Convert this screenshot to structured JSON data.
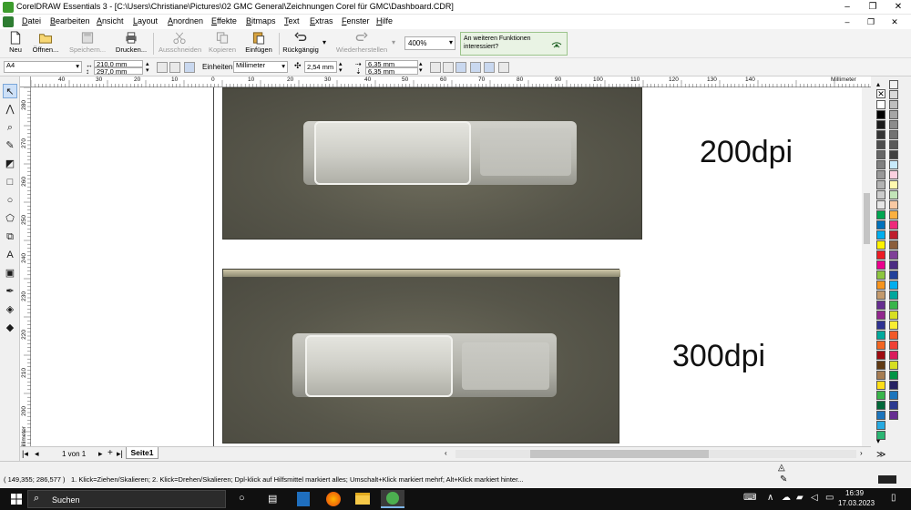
{
  "window": {
    "title": "CorelDRAW Essentials 3 - [C:\\Users\\Christiane\\Pictures\\02 GMC General\\Zeichnungen Corel für GMC\\Dashboard.CDR]",
    "controls": [
      "–",
      "❐",
      "✕"
    ]
  },
  "menu": {
    "items": [
      "Datei",
      "Bearbeiten",
      "Ansicht",
      "Layout",
      "Anordnen",
      "Effekte",
      "Bitmaps",
      "Text",
      "Extras",
      "Fenster",
      "Hilfe"
    ],
    "doc_controls": [
      "–",
      "❐",
      "✕"
    ]
  },
  "toolbar": {
    "buttons": [
      {
        "label": "Neu",
        "icon": "new-document-icon",
        "enabled": true
      },
      {
        "label": "Öffnen...",
        "icon": "open-folder-icon",
        "enabled": true
      },
      {
        "label": "Speichern...",
        "icon": "save-icon",
        "enabled": false
      },
      {
        "label": "Drucken...",
        "icon": "printer-icon",
        "enabled": true
      },
      {
        "label": "Ausschneiden",
        "icon": "scissors-icon",
        "enabled": false
      },
      {
        "label": "Kopieren",
        "icon": "copy-icon",
        "enabled": false
      },
      {
        "label": "Einfügen",
        "icon": "paste-icon",
        "enabled": true
      },
      {
        "label": "Rückgängig",
        "icon": "undo-icon",
        "enabled": true
      },
      {
        "label": "Wiederherstellen",
        "icon": "redo-icon",
        "enabled": false
      }
    ],
    "zoom": "400%",
    "promo_line1": "An weiteren Funktionen",
    "promo_line2": "interessiert?"
  },
  "propbar": {
    "page_size": "A4",
    "width": "210,0 mm",
    "height": "297,0 mm",
    "units_label": "Einheiten:",
    "units": "Millimeter",
    "nudge": "2,54 mm",
    "dup_x": "6,35 mm",
    "dup_y": "6,35 mm"
  },
  "rulers": {
    "h_ticks": [
      "40",
      "30",
      "20",
      "10",
      "0",
      "10",
      "20",
      "30",
      "40",
      "50",
      "60",
      "70",
      "80",
      "90",
      "100",
      "110",
      "120",
      "130",
      "140"
    ],
    "h_unit": "Millimeter",
    "v_ticks": [
      "280",
      "270",
      "260",
      "250",
      "240",
      "230",
      "220",
      "210",
      "200"
    ],
    "v_unit": "Millimeter"
  },
  "canvas": {
    "label_top": "200dpi",
    "label_bottom": "300dpi"
  },
  "navigation": {
    "page_count": "1 von 1",
    "page_tab": "Seite1"
  },
  "status": {
    "coords": "( 149,355; 286,577 )",
    "hint": "1. Klick=Ziehen/Skalieren; 2. Klick=Drehen/Skalieren; Dpl-klick auf Hilfsmittel markiert alles; Umschalt+Klick markiert mehrf; Alt+Klick markiert hinter..."
  },
  "taskbar": {
    "search_placeholder": "Suchen",
    "time": "16:39",
    "date": "17.03.2023"
  },
  "palette": {
    "colors_left": [
      "#ffffff",
      "#000000",
      "#1a1a1a",
      "#333333",
      "#4d4d4d",
      "#666666",
      "#808080",
      "#999999",
      "#b3b3b3",
      "#cccccc",
      "#e6e6e6",
      "#00a651",
      "#0072bc",
      "#00aeef",
      "#fff200",
      "#ed1c24",
      "#ec008c",
      "#8dc63f",
      "#f7941d",
      "#c49a6c",
      "#662d91",
      "#92278f",
      "#2e3192",
      "#00a99d",
      "#f26522",
      "#9e0b0f",
      "#603913",
      "#a67c52",
      "#ffde17",
      "#39b54a",
      "#006838",
      "#1b75bc",
      "#27aae1",
      "#2bb673"
    ],
    "colors_right": [
      "#f2f2f2",
      "#d9d9d9",
      "#bfbfbf",
      "#a6a6a6",
      "#8c8c8c",
      "#737373",
      "#5a5a5a",
      "#404040",
      "#c7eafb",
      "#fbd0e0",
      "#fff9ae",
      "#c2e5b8",
      "#f9c9a3",
      "#fbb040",
      "#ee2a7b",
      "#be1e2d",
      "#8b5e3c",
      "#7f3f98",
      "#4b2c83",
      "#21409a",
      "#00aeef",
      "#00a79d",
      "#39b54a",
      "#d7df23",
      "#f9ed32",
      "#f15a29",
      "#ef4136",
      "#da1c5c",
      "#d6de23",
      "#009444",
      "#262262",
      "#1c75bc",
      "#2b3990",
      "#662d91"
    ]
  }
}
